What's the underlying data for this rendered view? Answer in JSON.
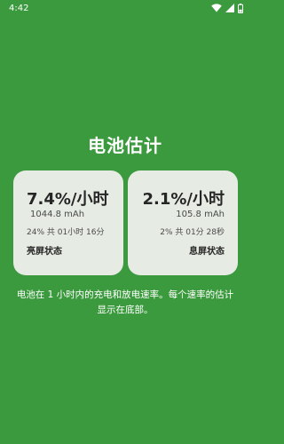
{
  "status_bar": {
    "time": "4:42",
    "icons": [
      "wifi-icon",
      "signal-icon",
      "battery-icon"
    ]
  },
  "page": {
    "title": "电池估计"
  },
  "cards": {
    "screen_on": {
      "rate": "7.4%/小时",
      "mah": "1044.8 mAh",
      "summary": "24% 共 01小时 16分",
      "state": "亮屏状态"
    },
    "screen_off": {
      "rate": "2.1%/小时",
      "mah": "105.8 mAh",
      "summary": "2% 共 01分 28秒",
      "state": "息屏状态"
    }
  },
  "description": {
    "line1": "电池在 1 小时内的充电和放电速率。每个速率的估计",
    "line2": "显示在底部。"
  },
  "colors": {
    "background": "#3c9a3e",
    "card": "#e6ebe4"
  }
}
